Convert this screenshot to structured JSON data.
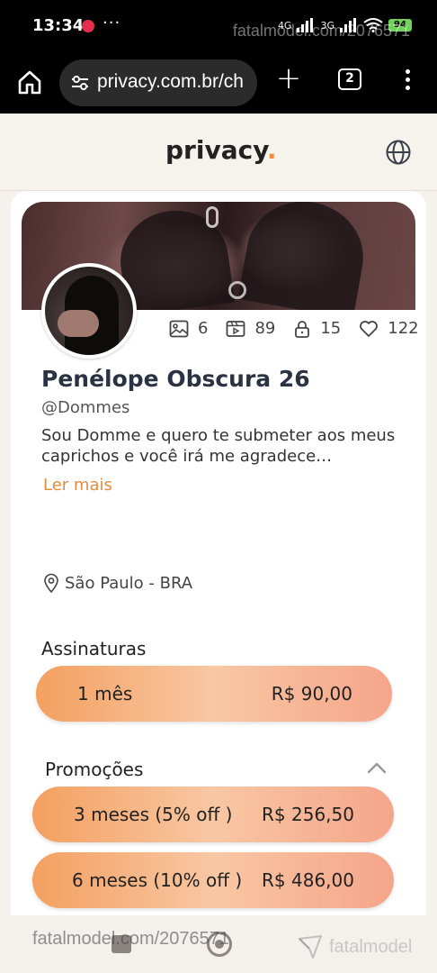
{
  "status_bar": {
    "time": "13:34",
    "network_1": "4G",
    "network_2": "3G",
    "battery": "94",
    "watermark": "fatalmodel.com/2076571"
  },
  "browser": {
    "url": "privacy.com.br/ch",
    "tab_count": "2",
    "new_tab_label": "+"
  },
  "site": {
    "logo_text": "privacy",
    "logo_dot": "."
  },
  "profile": {
    "stats": {
      "photos": "6",
      "videos": "89",
      "locked": "15",
      "likes": "122"
    },
    "name": "Penélope Obscura 26",
    "handle": "@Dommes",
    "bio": "Sou Domme e quero te submeter aos meus caprichos e você irá me agradece…",
    "read_more": "Ler mais",
    "location": "São Paulo - BRA"
  },
  "subscriptions": {
    "heading": "Assinaturas",
    "plans": [
      {
        "label": "1 mês",
        "price": "R$ 90,00"
      }
    ]
  },
  "promotions": {
    "heading": "Promoções",
    "plans": [
      {
        "label": "3 meses (5% off )",
        "price": "R$ 256,50"
      },
      {
        "label": "6 meses (10% off )",
        "price": "R$ 486,00"
      }
    ]
  },
  "watermarks": {
    "bottom_left": "fatalmodel.com/2076571",
    "bottom_right": "fatalmodel"
  },
  "colors": {
    "accent": "#e48c3c",
    "button_gradient_start": "#f4a060",
    "button_gradient_mid": "#f8c7a3",
    "button_gradient_end": "#f5a58a",
    "page_bg": "#f5f1ec",
    "title": "#2b3343"
  }
}
